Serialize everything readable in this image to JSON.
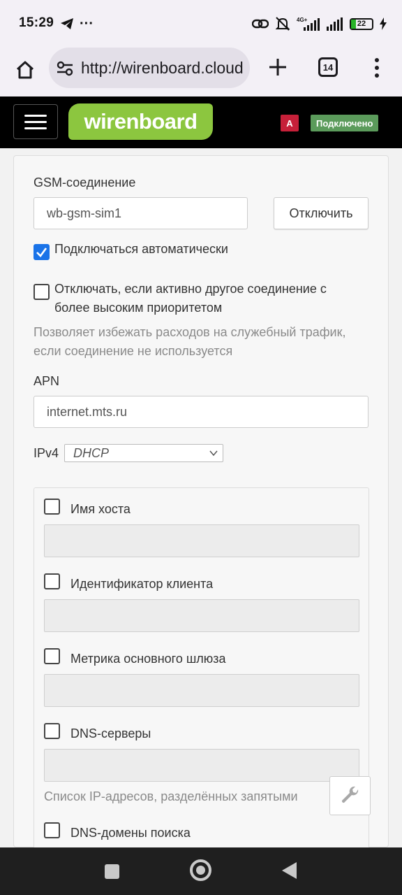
{
  "status_bar": {
    "time": "15:29",
    "battery": "22",
    "network_label": "4G+"
  },
  "browser": {
    "url": "http://wirenboard.cloud",
    "tab_count": "14"
  },
  "header": {
    "logo": "wirenboard",
    "user_badge": "A",
    "connection_status": "Подключено",
    "colors": {
      "logo_bg": "#8cc63f",
      "badge_bg": "#c62039",
      "status_bg": "#5b9b5b"
    }
  },
  "form": {
    "gsm_label": "GSM-соединение",
    "gsm_value": "wb-gsm-sim1",
    "disconnect_label": "Отключить",
    "auto_connect": {
      "label": "Подключаться автоматически",
      "checked": true
    },
    "disable_if_higher": {
      "line1": "Отключать, если активно другое соединение с",
      "line2": "более высоким приоритетом",
      "checked": false
    },
    "help_line1": "Позволяет избежать расходов на служебный трафик,",
    "help_line2": "если соединение не используется",
    "apn_label": "APN",
    "apn_value": "internet.mts.ru",
    "ipv4_label": "IPv4",
    "ipv4_value": "DHCP",
    "options": [
      {
        "label": "Имя хоста",
        "checked": false
      },
      {
        "label": "Идентификатор клиента",
        "checked": false
      },
      {
        "label": "Метрика основного шлюза",
        "checked": false
      },
      {
        "label": "DNS-серверы",
        "checked": false
      },
      {
        "label": "DNS-домены поиска",
        "checked": false
      }
    ],
    "dns_help": "Список IP-адресов, разделённых запятыми"
  }
}
